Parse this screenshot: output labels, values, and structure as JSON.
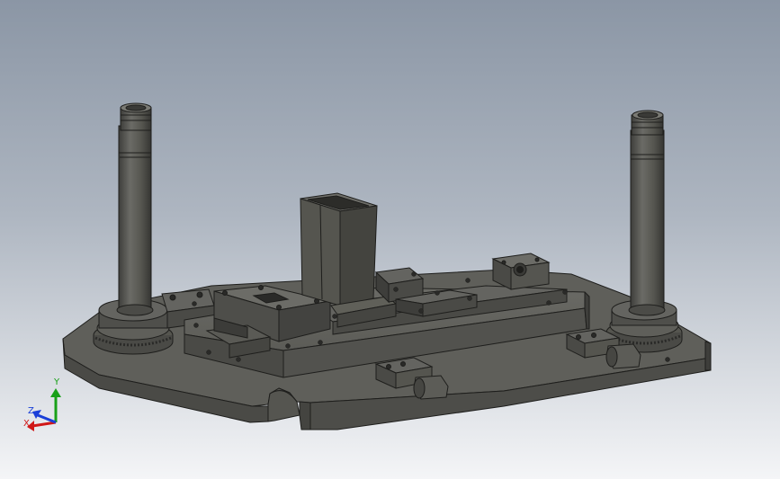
{
  "viewport": {
    "background_top": "#8c97a6",
    "background_bottom": "#f2f3f5",
    "model_color": "#5a5a56",
    "model_edge": "#1e1e1c"
  },
  "triad": {
    "x_label": "X",
    "y_label": "Y",
    "z_label": "Z",
    "x_color": "#d01818",
    "y_color": "#18a018",
    "z_color": "#1a3fd8",
    "icon": "axis-triad-icon"
  }
}
